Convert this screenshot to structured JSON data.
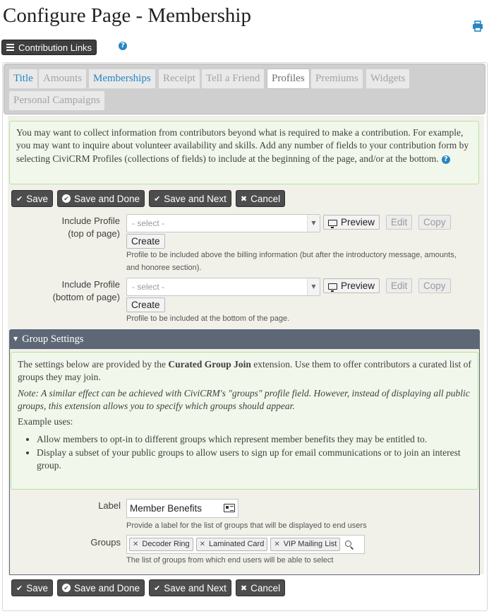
{
  "page": {
    "title": "Configure Page - Membership"
  },
  "top_bar": {
    "contribution_links_label": "Contribution Links"
  },
  "tabs": [
    {
      "label": "Title",
      "state": "valid"
    },
    {
      "label": "Amounts",
      "state": "disabled"
    },
    {
      "label": "Memberships",
      "state": "valid"
    },
    {
      "label": "Receipt",
      "state": "disabled"
    },
    {
      "label": "Tell a Friend",
      "state": "disabled"
    },
    {
      "label": "Profiles",
      "state": "active"
    },
    {
      "label": "Premiums",
      "state": "disabled"
    },
    {
      "label": "Widgets",
      "state": "disabled"
    },
    {
      "label": "Personal Campaigns",
      "state": "disabled"
    }
  ],
  "intro_help": "You may want to collect information from contributors beyond what is required to make a contribution. For example, you may want to inquire about volunteer availability and skills. Add any number of fields to your contribution form by selecting CiviCRM Profiles (collections of fields) to include at the beginning of the page, and/or at the bottom.",
  "actions": {
    "save": "Save",
    "save_done": "Save and Done",
    "save_next": "Save and Next",
    "cancel": "Cancel"
  },
  "profile_top": {
    "label_line1": "Include Profile",
    "label_line2": "(top of page)",
    "select_placeholder": "- select -",
    "preview": "Preview",
    "edit": "Edit",
    "copy": "Copy",
    "create": "Create",
    "description": "Profile to be included above the billing information (but after the introductory message, amounts, and honoree section)."
  },
  "profile_bottom": {
    "label_line1": "Include Profile",
    "label_line2": "(bottom of page)",
    "select_placeholder": "- select -",
    "preview": "Preview",
    "edit": "Edit",
    "copy": "Copy",
    "create": "Create",
    "description": "Profile to be included at the bottom of the page."
  },
  "group_settings": {
    "header": "Group Settings",
    "intro_before": "The settings below are provided by the ",
    "intro_bold": "Curated Group Join",
    "intro_after": " extension. Use them to offer contributors a curated list of groups they may join.",
    "note": "Note: A similar effect can be achieved with CiviCRM's \"groups\" profile field. However, instead of displaying all public groups, this extension allows you to specify which groups should appear.",
    "examples_title": "Example uses:",
    "examples": [
      "Allow members to opt-in to different groups which represent member benefits they may be entitled to.",
      "Display a subset of your public groups to allow users to sign up for email communications or to join an interest group."
    ],
    "label_field": {
      "label": "Label",
      "value": "Member Benefits",
      "description": "Provide a label for the list of groups that will be displayed to end users"
    },
    "groups_field": {
      "label": "Groups",
      "selected": [
        "Decoder Ring",
        "Laminated Card",
        "VIP Mailing List"
      ],
      "description": "The list of groups from which end users will be able to select"
    }
  }
}
